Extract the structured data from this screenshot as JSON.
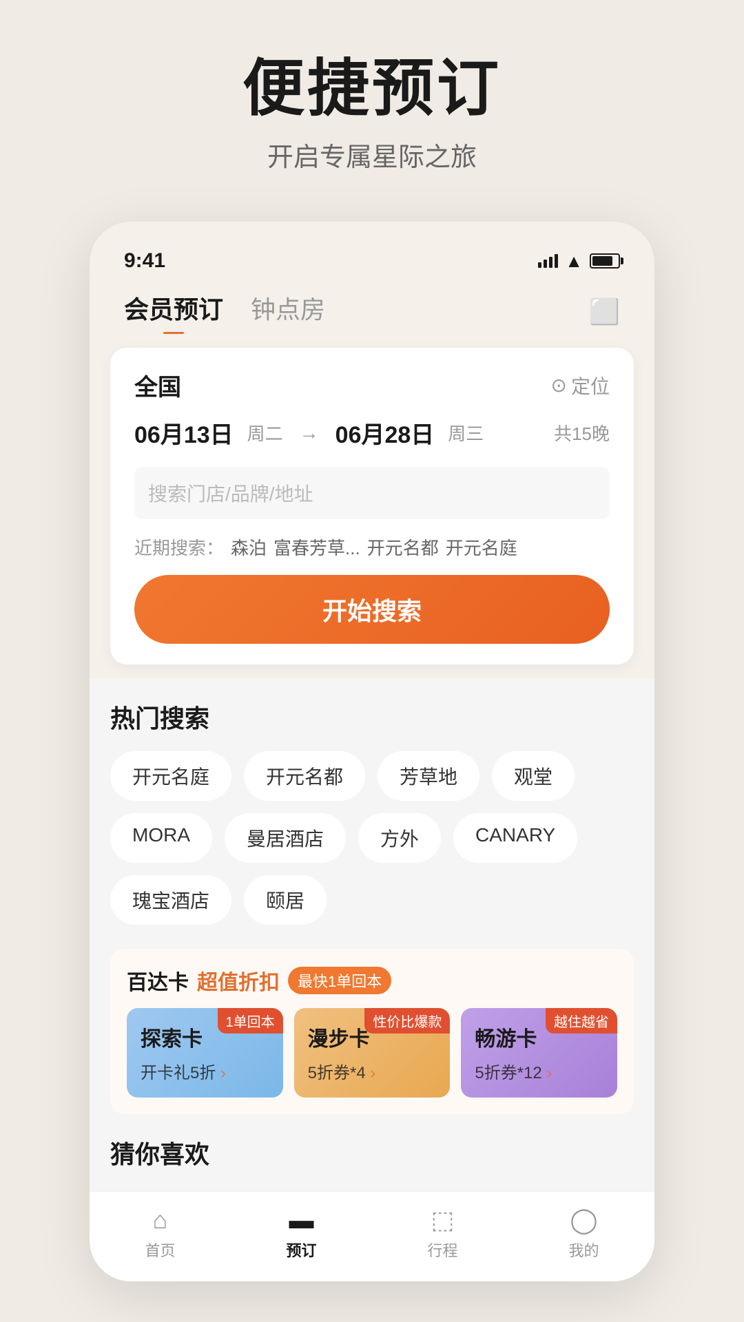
{
  "page": {
    "main_title": "便捷预订",
    "sub_title": "开启专属星际之旅"
  },
  "status_bar": {
    "time": "9:41"
  },
  "nav": {
    "tab_active": "会员预订",
    "tab_inactive": "钟点房",
    "scan_icon": "scan"
  },
  "search_card": {
    "location": "全国",
    "location_btn": "定位",
    "date_start": "06月13日",
    "date_start_day": "周二",
    "date_end": "06月28日",
    "date_end_day": "周三",
    "nights": "共15晚",
    "search_placeholder": "搜索门店/品牌/地址",
    "recent_label": "近期搜索：",
    "recent_items": [
      "森泊",
      "富春芳草...",
      "开元名都",
      "开元名庭"
    ],
    "search_btn": "开始搜索"
  },
  "hot_search": {
    "title": "热门搜索",
    "tags": [
      "开元名庭",
      "开元名都",
      "芳草地",
      "观堂",
      "MORA",
      "曼居酒店",
      "方外",
      "CANARY",
      "瑰宝酒店",
      "颐居"
    ]
  },
  "baidaka": {
    "title": "百达卡",
    "highlight": "超值折扣",
    "badge": "最快1单回本",
    "cards": [
      {
        "badge": "1单回本",
        "name": "探索卡",
        "desc": "开卡礼5折 ›",
        "color": "blue"
      },
      {
        "badge": "性价比爆款",
        "name": "漫步卡",
        "desc": "5折券*4 ›",
        "color": "orange"
      },
      {
        "badge": "越住越省",
        "name": "畅游卡",
        "desc": "5折券*12 ›",
        "color": "purple"
      }
    ]
  },
  "guess_like": {
    "title": "猜你喜欢"
  },
  "bottom_nav": {
    "items": [
      {
        "label": "首页",
        "icon": "home",
        "active": false
      },
      {
        "label": "预订",
        "icon": "booking",
        "active": true
      },
      {
        "label": "行程",
        "icon": "trip",
        "active": false
      },
      {
        "label": "我的",
        "icon": "profile",
        "active": false
      }
    ]
  }
}
